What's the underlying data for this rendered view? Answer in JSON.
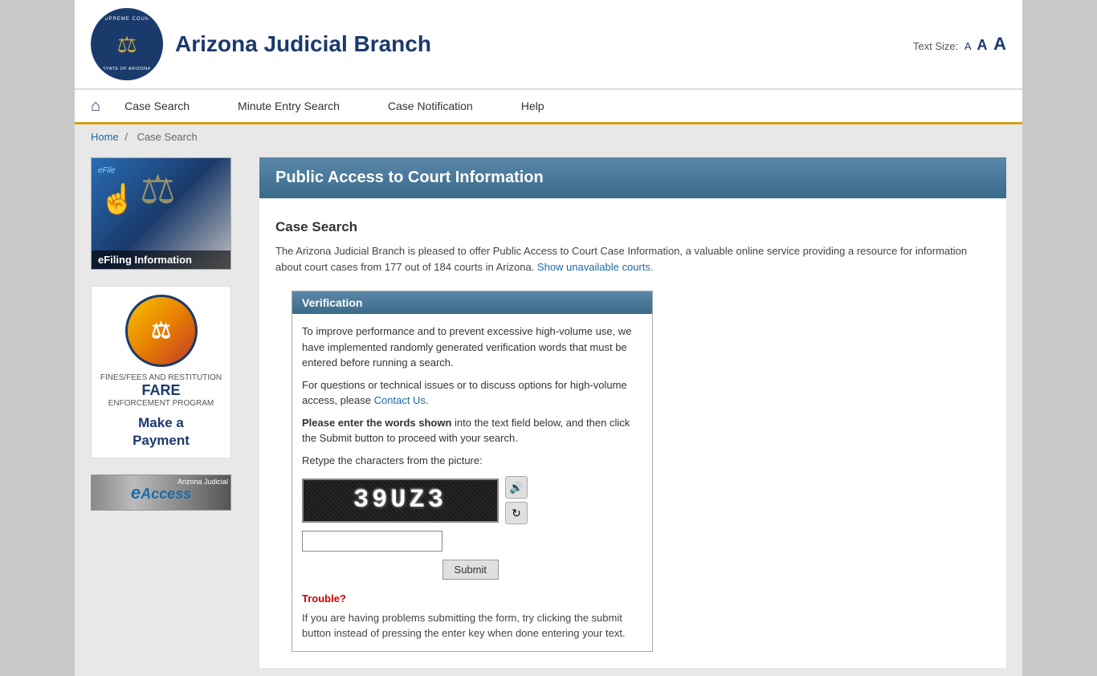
{
  "header": {
    "title": "Arizona Judicial Branch",
    "logo_alt": "Supreme Court State of Arizona seal",
    "text_size_label": "Text Size:",
    "text_size_small": "A",
    "text_size_medium": "A",
    "text_size_large": "A"
  },
  "nav": {
    "home_title": "Home",
    "links": [
      {
        "label": "Case Search",
        "href": "#"
      },
      {
        "label": "Minute Entry Search",
        "href": "#"
      },
      {
        "label": "Case Notification",
        "href": "#"
      },
      {
        "label": "Help",
        "href": "#"
      }
    ]
  },
  "breadcrumb": {
    "home": "Home",
    "separator": "/",
    "current": "Case Search"
  },
  "sidebar": {
    "efiling_label": "eFiling Information",
    "fare_label": "FINES/FEES AND RESTITUTION",
    "fare_acronym": "FARE",
    "fare_program": "ENFORCEMENT PROGRAM",
    "make_payment_line1": "Make a",
    "make_payment_line2": "Payment",
    "eaccess_label": "eAccess",
    "eaccess_site": "Arizona Judicial"
  },
  "main": {
    "panel_title": "Public Access to Court Information",
    "section_title": "Case Search",
    "intro_text": "The Arizona Judicial Branch is pleased to offer Public Access to Court Case Information, a valuable online service providing a resource for information about court cases from 177 out of 184 courts in Arizona.",
    "show_unavailable_link": "Show unavailable courts.",
    "verification": {
      "header": "Verification",
      "body_text_1": "To improve performance and to prevent excessive high-volume use, we have implemented randomly generated verification words that must be entered before running a search.",
      "body_text_2": "For questions or technical issues or to discuss options for high-volume access, please",
      "contact_link": "Contact Us",
      "body_text_3": ".",
      "instruction_bold": "Please enter the words shown",
      "instruction_rest": " into the text field below, and then click the Submit button to proceed with your search.",
      "retype_label": "Retype the characters from the picture:",
      "captcha_text": "39UZ3",
      "refresh_icon": "↻",
      "audio_icon": "🔊",
      "input_placeholder": "",
      "submit_label": "Submit",
      "trouble_title": "Trouble?",
      "trouble_text": "If you are having problems submitting the form, try clicking the submit button instead of pressing the enter key when done entering your text."
    }
  }
}
